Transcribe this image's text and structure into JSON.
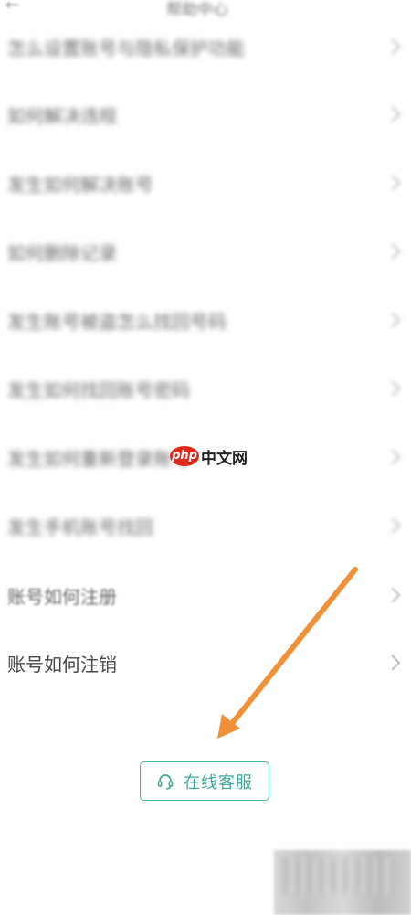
{
  "header": {
    "title": "帮助中心",
    "back_icon": "back-arrow-icon"
  },
  "faq": [
    {
      "label": "怎么设置账号与隐私保护功能"
    },
    {
      "label": "如何解决违规"
    },
    {
      "label": "发生如何解决账号"
    },
    {
      "label": "如何删除记录"
    },
    {
      "label": "发生账号被盗怎么找回号码"
    },
    {
      "label": "发生如何找回账号密码"
    },
    {
      "label": "发生如何重新登录账号"
    },
    {
      "label": "发生手机账号找回"
    },
    {
      "label": "账号如何注册"
    },
    {
      "label": "账号如何注销"
    }
  ],
  "support": {
    "button_label": "在线客服",
    "icon": "headset-icon",
    "accent_color": "#47b4a9"
  },
  "watermark": {
    "badge": "php",
    "text": "中文网"
  },
  "annotation": {
    "arrow_color": "#f0913a"
  }
}
